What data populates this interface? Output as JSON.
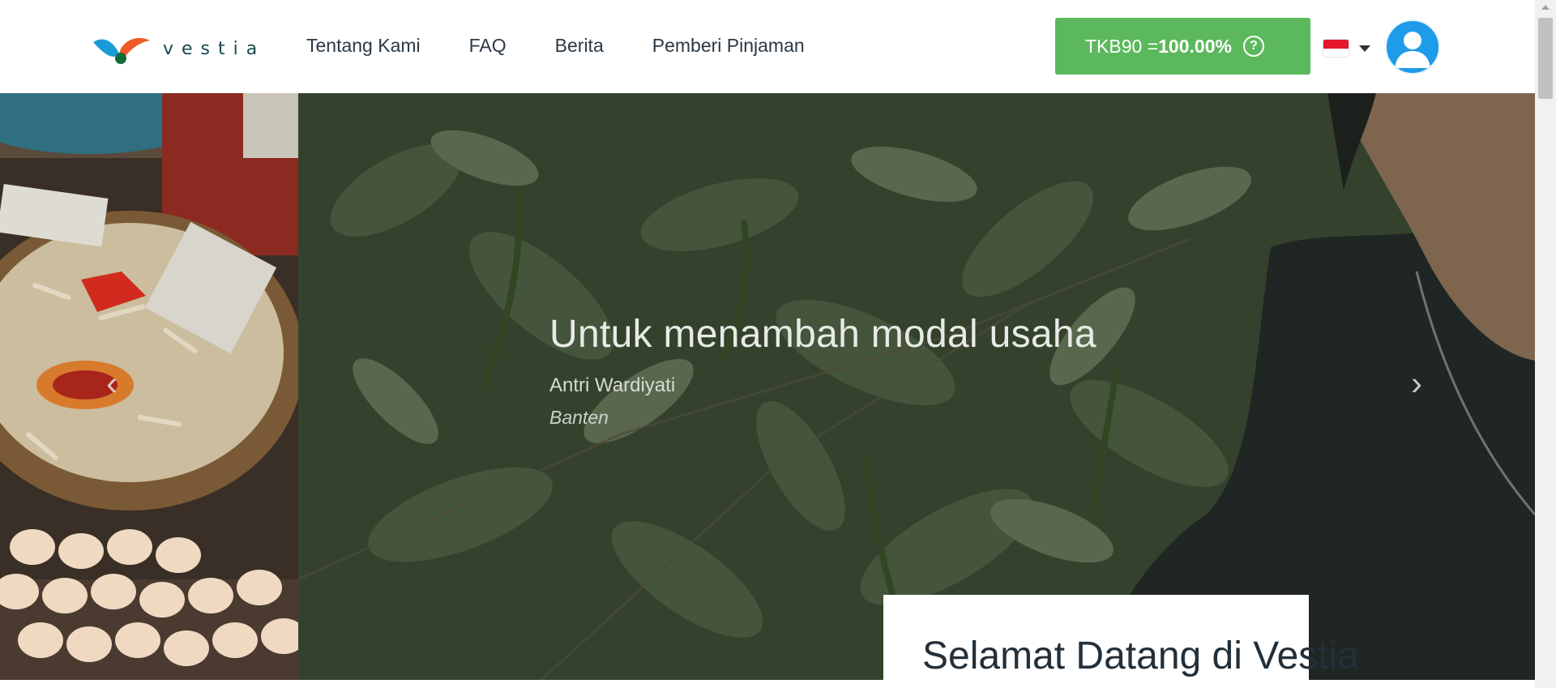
{
  "header": {
    "logo_text": "vestia",
    "nav": [
      {
        "label": "Tentang Kami"
      },
      {
        "label": "FAQ"
      },
      {
        "label": "Berita"
      },
      {
        "label": "Pemberi Pinjaman"
      }
    ],
    "tkb": {
      "prefix": "TKB90 =",
      "value": "100.00%",
      "help_icon": "question-circle-icon"
    },
    "language": {
      "flag": "indonesia-flag-icon"
    },
    "avatar_icon": "user-avatar-icon"
  },
  "hero": {
    "quote": "Untuk menambah modal usaha",
    "person": "Antri Wardiyati",
    "city": "Banten",
    "prev_icon": "chevron-left-icon",
    "next_icon": "chevron-right-icon"
  },
  "welcome": {
    "title": "Selamat Datang di Vestia"
  },
  "colors": {
    "tkb_green": "#5cb85c",
    "avatar_blue": "#1e9be9",
    "logo_teal": "#17494d",
    "logo_orange": "#f05a28",
    "logo_blue": "#1a9ad6"
  }
}
